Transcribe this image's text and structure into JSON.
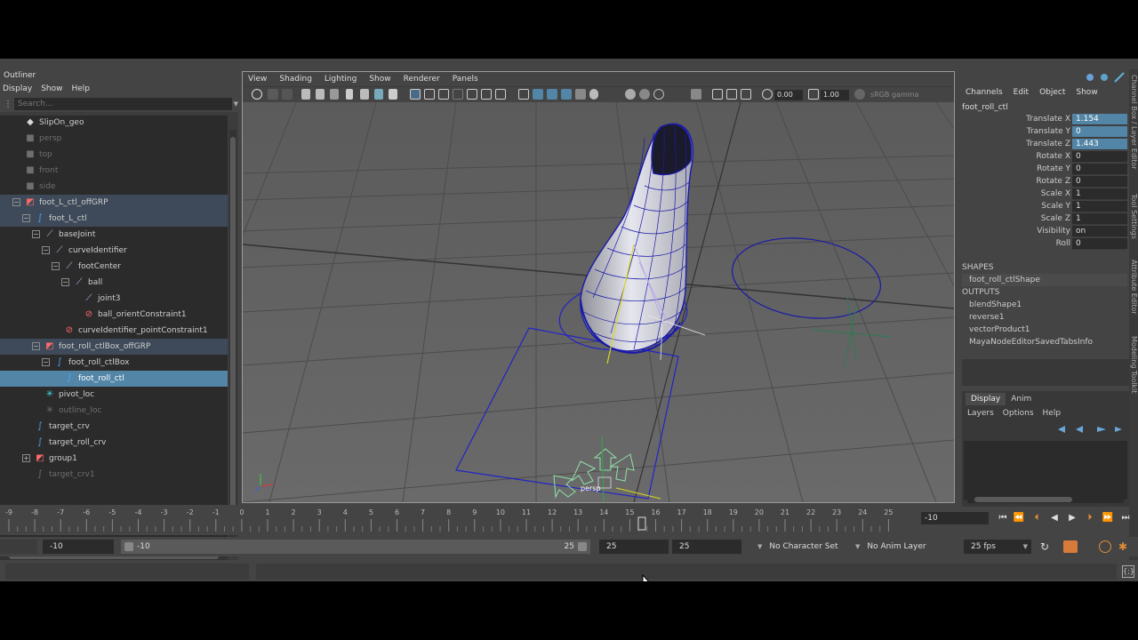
{
  "outliner": {
    "title": "Outliner",
    "menu": [
      "Display",
      "Show",
      "Help"
    ],
    "search_placeholder": "Search...",
    "items": [
      {
        "label": "SlipOn_geo",
        "depth": 0,
        "icon": "mesh-icon",
        "expander": "",
        "state": "normal",
        "dim": false
      },
      {
        "label": "persp",
        "depth": 0,
        "icon": "camera-icon",
        "expander": "",
        "state": "normal",
        "dim": true
      },
      {
        "label": "top",
        "depth": 0,
        "icon": "camera-icon",
        "expander": "",
        "state": "normal",
        "dim": true
      },
      {
        "label": "front",
        "depth": 0,
        "icon": "camera-icon",
        "expander": "",
        "state": "normal",
        "dim": true
      },
      {
        "label": "side",
        "depth": 0,
        "icon": "camera-icon",
        "expander": "",
        "state": "normal",
        "dim": true
      },
      {
        "label": "foot_L_ctl_offGRP",
        "depth": 0,
        "icon": "group-icon",
        "expander": "−",
        "state": "light",
        "dim": false
      },
      {
        "label": "foot_L_ctl",
        "depth": 1,
        "icon": "curve-icon",
        "expander": "−",
        "state": "light",
        "dim": false
      },
      {
        "label": "baseJoint",
        "depth": 2,
        "icon": "joint-icon",
        "expander": "−",
        "state": "normal",
        "dim": false
      },
      {
        "label": "curveIdentifier",
        "depth": 3,
        "icon": "joint-icon",
        "expander": "−",
        "state": "normal",
        "dim": false
      },
      {
        "label": "footCenter",
        "depth": 4,
        "icon": "joint-icon",
        "expander": "−",
        "state": "normal",
        "dim": false
      },
      {
        "label": "ball",
        "depth": 5,
        "icon": "joint-icon",
        "expander": "−",
        "state": "normal",
        "dim": false
      },
      {
        "label": "joint3",
        "depth": 6,
        "icon": "joint-icon",
        "expander": "",
        "state": "normal",
        "dim": false
      },
      {
        "label": "ball_orientConstraint1",
        "depth": 6,
        "icon": "constraint-icon",
        "expander": "",
        "state": "normal",
        "dim": false
      },
      {
        "label": "curveIdentifier_pointConstraint1",
        "depth": 4,
        "icon": "constraint-icon",
        "expander": "",
        "state": "normal",
        "dim": false
      },
      {
        "label": "foot_roll_ctlBox_offGRP",
        "depth": 2,
        "icon": "group-icon",
        "expander": "−",
        "state": "light",
        "dim": false
      },
      {
        "label": "foot_roll_ctlBox",
        "depth": 3,
        "icon": "curve-icon",
        "expander": "−",
        "state": "normal",
        "dim": false
      },
      {
        "label": "foot_roll_ctl",
        "depth": 4,
        "icon": "curve-icon",
        "expander": "",
        "state": "selected",
        "dim": false
      },
      {
        "label": "pivot_loc",
        "depth": 2,
        "icon": "locator-icon",
        "expander": "",
        "state": "normal",
        "dim": false
      },
      {
        "label": "outline_loc",
        "depth": 2,
        "icon": "locator-icon",
        "expander": "",
        "state": "normal",
        "dim": true
      },
      {
        "label": "target_crv",
        "depth": 1,
        "icon": "curve-icon",
        "expander": "",
        "state": "normal",
        "dim": false
      },
      {
        "label": "target_roll_crv",
        "depth": 1,
        "icon": "curve-icon",
        "expander": "",
        "state": "normal",
        "dim": false
      },
      {
        "label": "group1",
        "depth": 1,
        "icon": "group-icon",
        "expander": "+",
        "state": "normal",
        "dim": false
      },
      {
        "label": "target_crv1",
        "depth": 1,
        "icon": "curve-icon",
        "expander": "",
        "state": "normal",
        "dim": true
      }
    ]
  },
  "viewport": {
    "menu": [
      "View",
      "Shading",
      "Lighting",
      "Show",
      "Renderer",
      "Panels"
    ],
    "exposure": "0.00",
    "gamma": "1.00",
    "color_space": "sRGB gamma",
    "camera_label": "persp"
  },
  "channel_box": {
    "menu": [
      "Channels",
      "Edit",
      "Object",
      "Show"
    ],
    "node": "foot_roll_ctl",
    "channels": [
      {
        "label": "Translate X",
        "value": "1.154",
        "hl": true
      },
      {
        "label": "Translate Y",
        "value": "0",
        "hl": true
      },
      {
        "label": "Translate Z",
        "value": "1.443",
        "hl": true
      },
      {
        "label": "Rotate X",
        "value": "0",
        "hl": false
      },
      {
        "label": "Rotate Y",
        "value": "0",
        "hl": false
      },
      {
        "label": "Rotate Z",
        "value": "0",
        "hl": false
      },
      {
        "label": "Scale X",
        "value": "1",
        "hl": false
      },
      {
        "label": "Scale Y",
        "value": "1",
        "hl": false
      },
      {
        "label": "Scale Z",
        "value": "1",
        "hl": false
      },
      {
        "label": "Visibility",
        "value": "on",
        "hl": false
      },
      {
        "label": "Roll",
        "value": "0",
        "hl": false
      }
    ],
    "shapes_header": "SHAPES",
    "shapes": [
      "foot_roll_ctlShape"
    ],
    "outputs_header": "OUTPUTS",
    "outputs": [
      "blendShape1",
      "reverse1",
      "vectorProduct1",
      "MayaNodeEditorSavedTabsInfo"
    ],
    "side_tabs": [
      "Channel Box / Layer Editor",
      "Tool Settings",
      "Attribute Editor",
      "Modeling Toolkit"
    ]
  },
  "layer_editor": {
    "tabs": [
      "Display",
      "Anim"
    ],
    "menu": [
      "Layers",
      "Options",
      "Help"
    ]
  },
  "timeline": {
    "ticks": [
      "-9",
      "-8",
      "-7",
      "-6",
      "-5",
      "-4",
      "-3",
      "-2",
      "-1",
      "0",
      "1",
      "2",
      "3",
      "4",
      "5",
      "6",
      "7",
      "8",
      "9",
      "10",
      "11",
      "12",
      "13",
      "14",
      "15",
      "16",
      "17",
      "18",
      "19",
      "20",
      "21",
      "22",
      "23",
      "24",
      "25"
    ],
    "current_frame": "-10"
  },
  "range": {
    "start": "-10",
    "inner_start": "-10",
    "inner_end": "25",
    "end": "25",
    "end2": "25",
    "character_set": "No Character Set",
    "anim_layer": "No Anim Layer",
    "fps": "25 fps"
  },
  "colors": {
    "selection": "#5285a6",
    "wire_dark_blue": "#1a1aa8",
    "ctl_blue": "#2323c8"
  }
}
